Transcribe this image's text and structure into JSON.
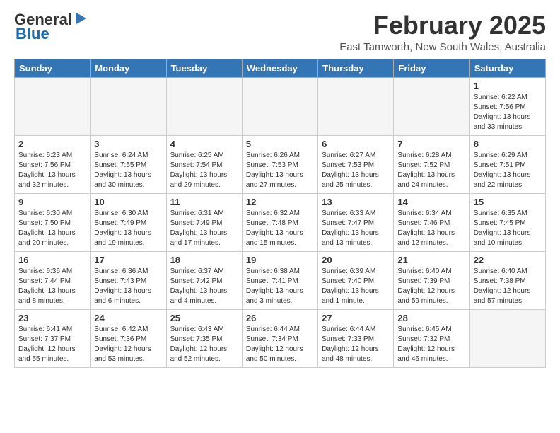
{
  "header": {
    "logo_general": "General",
    "logo_blue": "Blue",
    "month_title": "February 2025",
    "subtitle": "East Tamworth, New South Wales, Australia"
  },
  "weekdays": [
    "Sunday",
    "Monday",
    "Tuesday",
    "Wednesday",
    "Thursday",
    "Friday",
    "Saturday"
  ],
  "weeks": [
    [
      {
        "day": "",
        "info": ""
      },
      {
        "day": "",
        "info": ""
      },
      {
        "day": "",
        "info": ""
      },
      {
        "day": "",
        "info": ""
      },
      {
        "day": "",
        "info": ""
      },
      {
        "day": "",
        "info": ""
      },
      {
        "day": "1",
        "info": "Sunrise: 6:22 AM\nSunset: 7:56 PM\nDaylight: 13 hours\nand 33 minutes."
      }
    ],
    [
      {
        "day": "2",
        "info": "Sunrise: 6:23 AM\nSunset: 7:56 PM\nDaylight: 13 hours\nand 32 minutes."
      },
      {
        "day": "3",
        "info": "Sunrise: 6:24 AM\nSunset: 7:55 PM\nDaylight: 13 hours\nand 30 minutes."
      },
      {
        "day": "4",
        "info": "Sunrise: 6:25 AM\nSunset: 7:54 PM\nDaylight: 13 hours\nand 29 minutes."
      },
      {
        "day": "5",
        "info": "Sunrise: 6:26 AM\nSunset: 7:53 PM\nDaylight: 13 hours\nand 27 minutes."
      },
      {
        "day": "6",
        "info": "Sunrise: 6:27 AM\nSunset: 7:53 PM\nDaylight: 13 hours\nand 25 minutes."
      },
      {
        "day": "7",
        "info": "Sunrise: 6:28 AM\nSunset: 7:52 PM\nDaylight: 13 hours\nand 24 minutes."
      },
      {
        "day": "8",
        "info": "Sunrise: 6:29 AM\nSunset: 7:51 PM\nDaylight: 13 hours\nand 22 minutes."
      }
    ],
    [
      {
        "day": "9",
        "info": "Sunrise: 6:30 AM\nSunset: 7:50 PM\nDaylight: 13 hours\nand 20 minutes."
      },
      {
        "day": "10",
        "info": "Sunrise: 6:30 AM\nSunset: 7:49 PM\nDaylight: 13 hours\nand 19 minutes."
      },
      {
        "day": "11",
        "info": "Sunrise: 6:31 AM\nSunset: 7:49 PM\nDaylight: 13 hours\nand 17 minutes."
      },
      {
        "day": "12",
        "info": "Sunrise: 6:32 AM\nSunset: 7:48 PM\nDaylight: 13 hours\nand 15 minutes."
      },
      {
        "day": "13",
        "info": "Sunrise: 6:33 AM\nSunset: 7:47 PM\nDaylight: 13 hours\nand 13 minutes."
      },
      {
        "day": "14",
        "info": "Sunrise: 6:34 AM\nSunset: 7:46 PM\nDaylight: 13 hours\nand 12 minutes."
      },
      {
        "day": "15",
        "info": "Sunrise: 6:35 AM\nSunset: 7:45 PM\nDaylight: 13 hours\nand 10 minutes."
      }
    ],
    [
      {
        "day": "16",
        "info": "Sunrise: 6:36 AM\nSunset: 7:44 PM\nDaylight: 13 hours\nand 8 minutes."
      },
      {
        "day": "17",
        "info": "Sunrise: 6:36 AM\nSunset: 7:43 PM\nDaylight: 13 hours\nand 6 minutes."
      },
      {
        "day": "18",
        "info": "Sunrise: 6:37 AM\nSunset: 7:42 PM\nDaylight: 13 hours\nand 4 minutes."
      },
      {
        "day": "19",
        "info": "Sunrise: 6:38 AM\nSunset: 7:41 PM\nDaylight: 13 hours\nand 3 minutes."
      },
      {
        "day": "20",
        "info": "Sunrise: 6:39 AM\nSunset: 7:40 PM\nDaylight: 13 hours\nand 1 minute."
      },
      {
        "day": "21",
        "info": "Sunrise: 6:40 AM\nSunset: 7:39 PM\nDaylight: 12 hours\nand 59 minutes."
      },
      {
        "day": "22",
        "info": "Sunrise: 6:40 AM\nSunset: 7:38 PM\nDaylight: 12 hours\nand 57 minutes."
      }
    ],
    [
      {
        "day": "23",
        "info": "Sunrise: 6:41 AM\nSunset: 7:37 PM\nDaylight: 12 hours\nand 55 minutes."
      },
      {
        "day": "24",
        "info": "Sunrise: 6:42 AM\nSunset: 7:36 PM\nDaylight: 12 hours\nand 53 minutes."
      },
      {
        "day": "25",
        "info": "Sunrise: 6:43 AM\nSunset: 7:35 PM\nDaylight: 12 hours\nand 52 minutes."
      },
      {
        "day": "26",
        "info": "Sunrise: 6:44 AM\nSunset: 7:34 PM\nDaylight: 12 hours\nand 50 minutes."
      },
      {
        "day": "27",
        "info": "Sunrise: 6:44 AM\nSunset: 7:33 PM\nDaylight: 12 hours\nand 48 minutes."
      },
      {
        "day": "28",
        "info": "Sunrise: 6:45 AM\nSunset: 7:32 PM\nDaylight: 12 hours\nand 46 minutes."
      },
      {
        "day": "",
        "info": ""
      }
    ]
  ]
}
